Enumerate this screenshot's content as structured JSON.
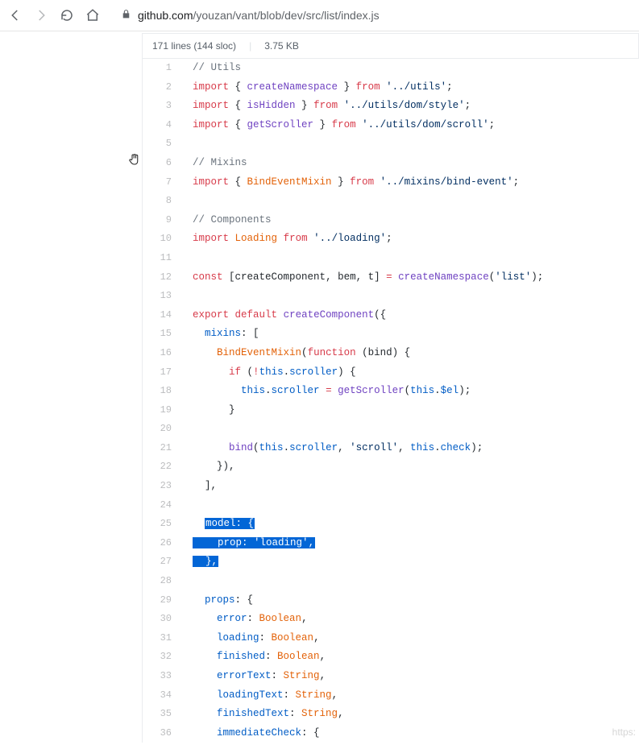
{
  "browser": {
    "url_host": "github.com",
    "url_path": "/youzan/vant/blob/dev/src/list/index.js"
  },
  "file_header": {
    "lines_text": "171 lines (144 sloc)",
    "size_text": "3.75 KB"
  },
  "code": {
    "lines": [
      {
        "n": 1,
        "tokens": [
          {
            "t": "// Utils",
            "c": "c1"
          }
        ]
      },
      {
        "n": 2,
        "tokens": [
          {
            "t": "import",
            "c": "kw"
          },
          {
            "t": " { ",
            "c": "pl"
          },
          {
            "t": "createNamespace",
            "c": "fn"
          },
          {
            "t": " } ",
            "c": "pl"
          },
          {
            "t": "from",
            "c": "kw"
          },
          {
            "t": " ",
            "c": "pl"
          },
          {
            "t": "'../utils'",
            "c": "st"
          },
          {
            "t": ";",
            "c": "pl"
          }
        ]
      },
      {
        "n": 3,
        "tokens": [
          {
            "t": "import",
            "c": "kw"
          },
          {
            "t": " { ",
            "c": "pl"
          },
          {
            "t": "isHidden",
            "c": "fn"
          },
          {
            "t": " } ",
            "c": "pl"
          },
          {
            "t": "from",
            "c": "kw"
          },
          {
            "t": " ",
            "c": "pl"
          },
          {
            "t": "'../utils/dom/style'",
            "c": "st"
          },
          {
            "t": ";",
            "c": "pl"
          }
        ]
      },
      {
        "n": 4,
        "tokens": [
          {
            "t": "import",
            "c": "kw"
          },
          {
            "t": " { ",
            "c": "pl"
          },
          {
            "t": "getScroller",
            "c": "fn"
          },
          {
            "t": " } ",
            "c": "pl"
          },
          {
            "t": "from",
            "c": "kw"
          },
          {
            "t": " ",
            "c": "pl"
          },
          {
            "t": "'../utils/dom/scroll'",
            "c": "st"
          },
          {
            "t": ";",
            "c": "pl"
          }
        ]
      },
      {
        "n": 5,
        "tokens": []
      },
      {
        "n": 6,
        "tokens": [
          {
            "t": "// Mixins",
            "c": "c1"
          }
        ]
      },
      {
        "n": 7,
        "tokens": [
          {
            "t": "import",
            "c": "kw"
          },
          {
            "t": " { ",
            "c": "pl"
          },
          {
            "t": "BindEventMixin",
            "c": "nm"
          },
          {
            "t": " } ",
            "c": "pl"
          },
          {
            "t": "from",
            "c": "kw"
          },
          {
            "t": " ",
            "c": "pl"
          },
          {
            "t": "'../mixins/bind-event'",
            "c": "st"
          },
          {
            "t": ";",
            "c": "pl"
          }
        ]
      },
      {
        "n": 8,
        "tokens": []
      },
      {
        "n": 9,
        "tokens": [
          {
            "t": "// Components",
            "c": "c1"
          }
        ]
      },
      {
        "n": 10,
        "tokens": [
          {
            "t": "import",
            "c": "kw"
          },
          {
            "t": " ",
            "c": "pl"
          },
          {
            "t": "Loading",
            "c": "nm"
          },
          {
            "t": " ",
            "c": "pl"
          },
          {
            "t": "from",
            "c": "kw"
          },
          {
            "t": " ",
            "c": "pl"
          },
          {
            "t": "'../loading'",
            "c": "st"
          },
          {
            "t": ";",
            "c": "pl"
          }
        ]
      },
      {
        "n": 11,
        "tokens": []
      },
      {
        "n": 12,
        "tokens": [
          {
            "t": "const",
            "c": "kw"
          },
          {
            "t": " [",
            "c": "pl"
          },
          {
            "t": "createComponent",
            "c": "pl"
          },
          {
            "t": ", ",
            "c": "pl"
          },
          {
            "t": "bem",
            "c": "pl"
          },
          {
            "t": ", ",
            "c": "pl"
          },
          {
            "t": "t",
            "c": "pl"
          },
          {
            "t": "] ",
            "c": "pl"
          },
          {
            "t": "=",
            "c": "kw"
          },
          {
            "t": " ",
            "c": "pl"
          },
          {
            "t": "createNamespace",
            "c": "fn"
          },
          {
            "t": "(",
            "c": "pl"
          },
          {
            "t": "'list'",
            "c": "st"
          },
          {
            "t": ");",
            "c": "pl"
          }
        ]
      },
      {
        "n": 13,
        "tokens": []
      },
      {
        "n": 14,
        "tokens": [
          {
            "t": "export",
            "c": "kw"
          },
          {
            "t": " ",
            "c": "pl"
          },
          {
            "t": "default",
            "c": "kw"
          },
          {
            "t": " ",
            "c": "pl"
          },
          {
            "t": "createComponent",
            "c": "fn"
          },
          {
            "t": "({",
            "c": "pl"
          }
        ]
      },
      {
        "n": 15,
        "tokens": [
          {
            "t": "  ",
            "c": "pl"
          },
          {
            "t": "mixins",
            "c": "bl"
          },
          {
            "t": ": [",
            "c": "pl"
          }
        ]
      },
      {
        "n": 16,
        "tokens": [
          {
            "t": "    ",
            "c": "pl"
          },
          {
            "t": "BindEventMixin",
            "c": "nm"
          },
          {
            "t": "(",
            "c": "pl"
          },
          {
            "t": "function",
            "c": "kw"
          },
          {
            "t": " (",
            "c": "pl"
          },
          {
            "t": "bind",
            "c": "pl"
          },
          {
            "t": ") {",
            "c": "pl"
          }
        ]
      },
      {
        "n": 17,
        "tokens": [
          {
            "t": "      ",
            "c": "pl"
          },
          {
            "t": "if",
            "c": "kw"
          },
          {
            "t": " (",
            "c": "pl"
          },
          {
            "t": "!",
            "c": "kw"
          },
          {
            "t": "this",
            "c": "bl"
          },
          {
            "t": ".",
            "c": "pl"
          },
          {
            "t": "scroller",
            "c": "bl"
          },
          {
            "t": ") {",
            "c": "pl"
          }
        ]
      },
      {
        "n": 18,
        "tokens": [
          {
            "t": "        ",
            "c": "pl"
          },
          {
            "t": "this",
            "c": "bl"
          },
          {
            "t": ".",
            "c": "pl"
          },
          {
            "t": "scroller",
            "c": "bl"
          },
          {
            "t": " ",
            "c": "pl"
          },
          {
            "t": "=",
            "c": "kw"
          },
          {
            "t": " ",
            "c": "pl"
          },
          {
            "t": "getScroller",
            "c": "fn"
          },
          {
            "t": "(",
            "c": "pl"
          },
          {
            "t": "this",
            "c": "bl"
          },
          {
            "t": ".",
            "c": "pl"
          },
          {
            "t": "$el",
            "c": "bl"
          },
          {
            "t": ");",
            "c": "pl"
          }
        ]
      },
      {
        "n": 19,
        "tokens": [
          {
            "t": "      }",
            "c": "pl"
          }
        ]
      },
      {
        "n": 20,
        "tokens": []
      },
      {
        "n": 21,
        "tokens": [
          {
            "t": "      ",
            "c": "pl"
          },
          {
            "t": "bind",
            "c": "fn"
          },
          {
            "t": "(",
            "c": "pl"
          },
          {
            "t": "this",
            "c": "bl"
          },
          {
            "t": ".",
            "c": "pl"
          },
          {
            "t": "scroller",
            "c": "bl"
          },
          {
            "t": ", ",
            "c": "pl"
          },
          {
            "t": "'scroll'",
            "c": "st"
          },
          {
            "t": ", ",
            "c": "pl"
          },
          {
            "t": "this",
            "c": "bl"
          },
          {
            "t": ".",
            "c": "pl"
          },
          {
            "t": "check",
            "c": "bl"
          },
          {
            "t": ");",
            "c": "pl"
          }
        ]
      },
      {
        "n": 22,
        "tokens": [
          {
            "t": "    }),",
            "c": "pl"
          }
        ]
      },
      {
        "n": 23,
        "tokens": [
          {
            "t": "  ],",
            "c": "pl"
          }
        ]
      },
      {
        "n": 24,
        "tokens": []
      },
      {
        "n": 25,
        "sel": true,
        "tokens": [
          {
            "t": "  ",
            "c": "pl"
          },
          {
            "t": "model",
            "c": "bl",
            "sel": true
          },
          {
            "t": ": {",
            "c": "pl",
            "sel": true
          }
        ]
      },
      {
        "n": 26,
        "sel": true,
        "tokens": [
          {
            "t": "    ",
            "c": "pl",
            "sel": true
          },
          {
            "t": "prop",
            "c": "bl",
            "sel": true
          },
          {
            "t": ": ",
            "c": "pl",
            "sel": true
          },
          {
            "t": "'loading'",
            "c": "st",
            "sel": true
          },
          {
            "t": ",",
            "c": "pl",
            "sel": true
          }
        ]
      },
      {
        "n": 27,
        "sel": true,
        "tokens": [
          {
            "t": "  ",
            "c": "pl",
            "sel": true
          },
          {
            "t": "},",
            "c": "pl",
            "sel": true
          }
        ]
      },
      {
        "n": 28,
        "tokens": []
      },
      {
        "n": 29,
        "tokens": [
          {
            "t": "  ",
            "c": "pl"
          },
          {
            "t": "props",
            "c": "bl"
          },
          {
            "t": ": {",
            "c": "pl"
          }
        ]
      },
      {
        "n": 30,
        "tokens": [
          {
            "t": "    ",
            "c": "pl"
          },
          {
            "t": "error",
            "c": "bl"
          },
          {
            "t": ": ",
            "c": "pl"
          },
          {
            "t": "Boolean",
            "c": "nm"
          },
          {
            "t": ",",
            "c": "pl"
          }
        ]
      },
      {
        "n": 31,
        "tokens": [
          {
            "t": "    ",
            "c": "pl"
          },
          {
            "t": "loading",
            "c": "bl"
          },
          {
            "t": ": ",
            "c": "pl"
          },
          {
            "t": "Boolean",
            "c": "nm"
          },
          {
            "t": ",",
            "c": "pl"
          }
        ]
      },
      {
        "n": 32,
        "tokens": [
          {
            "t": "    ",
            "c": "pl"
          },
          {
            "t": "finished",
            "c": "bl"
          },
          {
            "t": ": ",
            "c": "pl"
          },
          {
            "t": "Boolean",
            "c": "nm"
          },
          {
            "t": ",",
            "c": "pl"
          }
        ]
      },
      {
        "n": 33,
        "tokens": [
          {
            "t": "    ",
            "c": "pl"
          },
          {
            "t": "errorText",
            "c": "bl"
          },
          {
            "t": ": ",
            "c": "pl"
          },
          {
            "t": "String",
            "c": "nm"
          },
          {
            "t": ",",
            "c": "pl"
          }
        ]
      },
      {
        "n": 34,
        "tokens": [
          {
            "t": "    ",
            "c": "pl"
          },
          {
            "t": "loadingText",
            "c": "bl"
          },
          {
            "t": ": ",
            "c": "pl"
          },
          {
            "t": "String",
            "c": "nm"
          },
          {
            "t": ",",
            "c": "pl"
          }
        ]
      },
      {
        "n": 35,
        "tokens": [
          {
            "t": "    ",
            "c": "pl"
          },
          {
            "t": "finishedText",
            "c": "bl"
          },
          {
            "t": ": ",
            "c": "pl"
          },
          {
            "t": "String",
            "c": "nm"
          },
          {
            "t": ",",
            "c": "pl"
          }
        ]
      },
      {
        "n": 36,
        "tokens": [
          {
            "t": "    ",
            "c": "pl"
          },
          {
            "t": "immediateCheck",
            "c": "bl"
          },
          {
            "t": ": {",
            "c": "pl"
          }
        ]
      }
    ]
  },
  "watermark": "https:"
}
